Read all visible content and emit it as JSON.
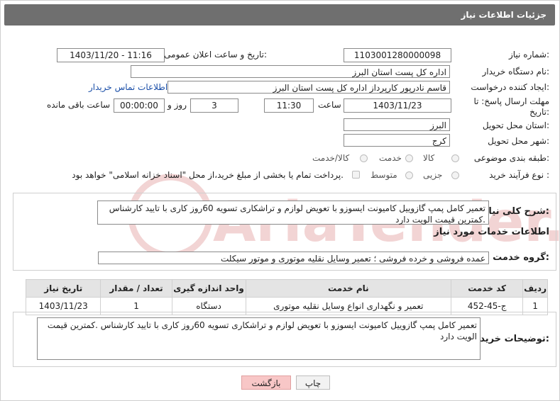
{
  "header": {
    "title": "جزئیات اطلاعات نیاز"
  },
  "form": {
    "need_number_label": "شماره نیاز:",
    "need_number": "1103001280000098",
    "announce_label": "تاریخ و ساعت اعلان عمومی:",
    "announce_value": "1403/11/20 - 11:16",
    "buyer_org_label": "نام دستگاه خریدار:",
    "buyer_org": "اداره کل پست استان البرز",
    "creator_label": "ایجاد کننده درخواست:",
    "creator": "قاسم نادرپور کارپرداز اداره کل پست استان البرز",
    "contact_link": "اطلاعات تماس خریدار",
    "deadline_label_1": "مهلت ارسال پاسخ: تا",
    "deadline_label_2": "تاریخ:",
    "deadline_date": "1403/11/23",
    "time_label": "ساعت",
    "deadline_time": "11:30",
    "days": "3",
    "days_label": "روز و",
    "remaining": "00:00:00",
    "remaining_label": "ساعت باقی مانده",
    "province_label": "استان محل تحویل:",
    "province": "البرز",
    "city_label": "شهر محل تحویل:",
    "city": "کرج",
    "category_label": "طبقه بندی موضوعی:",
    "category_options": [
      "کالا",
      "خدمت",
      "کالا/خدمت"
    ],
    "process_label": "نوع فرآیند خرید :",
    "process_options": [
      "جزیی",
      "متوسط"
    ],
    "payment_note": "پرداخت تمام یا بخشی از مبلغ خرید،از محل \"اسناد خزانه اسلامی\" خواهد بود."
  },
  "summary": {
    "label": "شرح کلی نیاز:",
    "text": "تعمیر کامل پمپ گازوییل کامیونت ایسوزو  با تعویض لوازم و تراشکاری تسویه 60روز کاری با تایید کارشناس .کمترین قیمت الویت دارد"
  },
  "services": {
    "heading": "اطلاعات خدمات مورد نیاز",
    "group_label": "گروه خدمت:",
    "group_value": "عمده فروشی و خرده فروشی ؛ تعمیر وسایل نقلیه موتوری و موتور سیکلت",
    "columns": [
      "ردیف",
      "کد خدمت",
      "نام خدمت",
      "واحد اندازه گیری",
      "تعداد / مقدار",
      "تاریخ نیاز"
    ],
    "rows": [
      [
        "1",
        "ج-45-452",
        "تعمیر و نگهداری انواع وسایل نقلیه موتوری",
        "دستگاه",
        "1",
        "1403/11/23"
      ]
    ]
  },
  "buyer_notes": {
    "label": "توضیحات خریدار:",
    "text": "تعمیر کامل پمپ گازوییل کامیونت ایسوزو  با تعویض لوازم و تراشکاری تسویه 60روز کاری با تایید کارشناس .کمترین قیمت الویت دارد"
  },
  "buttons": {
    "print": "چاپ",
    "back": "بازگشت"
  },
  "colors": {
    "title_bar": "#6f6f6f",
    "back_button": "#f8c7c7",
    "link": "#1b4fa8",
    "watermark": "#f2d4d4"
  },
  "watermark": "AriaTender.neT"
}
